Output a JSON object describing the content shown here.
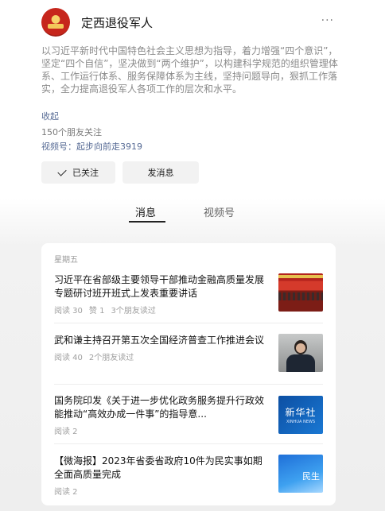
{
  "header": {
    "account_name": "定西退役军人",
    "more_label": "···"
  },
  "profile": {
    "description": "以习近平新时代中国特色社会主义思想为指导，着力增强“四个意识”，坚定“四个自信”，坚决做到“两个维护”，以构建科学规范的组织管理体系、工作运行体系、服务保障体系为主线，坚持问题导向，狠抓工作落实，全力提高退役军人各项工作的层次和水平。",
    "collapse_label": "收起",
    "followers_text": "150个朋友关注",
    "video_account_text": "视频号：起步向前走3919"
  },
  "actions": {
    "followed_label": "已关注",
    "message_label": "发消息"
  },
  "tabs": [
    {
      "label": "消息",
      "active": true
    },
    {
      "label": "视频号",
      "active": false
    }
  ],
  "feed": {
    "weekday": "星期五",
    "articles": [
      {
        "title": "习近平在省部级主要领导干部推动金融高质量发展专题研讨班开班式上发表重要讲话",
        "meta": [
          "阅读 30",
          "赞 1",
          "3个朋友读过"
        ],
        "thumb": "conference-hall"
      },
      {
        "title": "武和谦主持召开第五次全国经济普查工作推进会议",
        "meta": [
          "阅读 40",
          "2个朋友读过"
        ],
        "thumb": "official-portrait"
      },
      {
        "title": "国务院印发《关于进一步优化政务服务提升行政效能推动“高效办成一件事”的指导意...",
        "meta": [
          "阅读 2"
        ],
        "thumb": "xinhua-news",
        "thumb_text": "新华社",
        "thumb_subtext": "XINHUA NEWS"
      },
      {
        "title": "【微海报】2023年省委省政府10件为民实事如期全面高质量完成",
        "meta": [
          "阅读 2"
        ],
        "thumb": "minsheng-poster",
        "thumb_text": "民生"
      }
    ]
  },
  "colors": {
    "link_blue": "#576b95",
    "muted_gray": "#8a8a8a",
    "button_bg": "#f2f2f2"
  }
}
